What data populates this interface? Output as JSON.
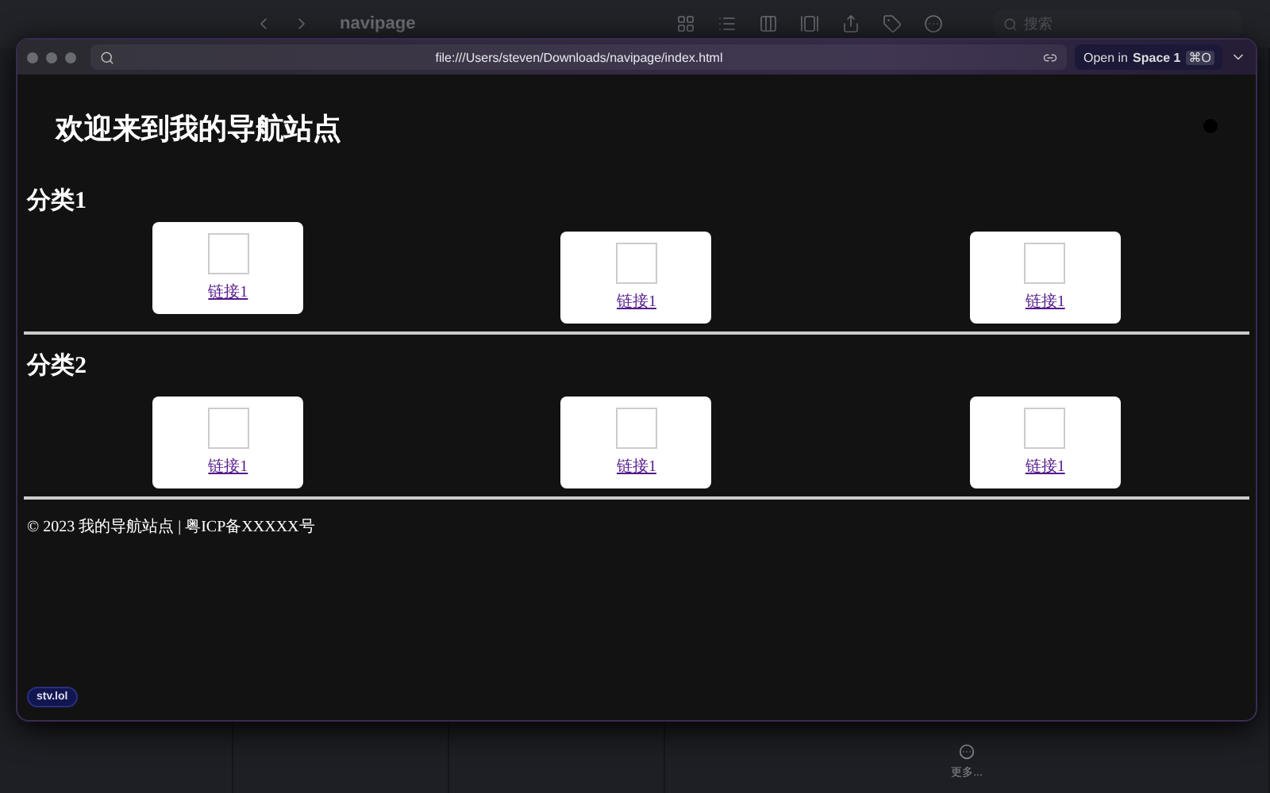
{
  "finder": {
    "title": "navipage",
    "search": {
      "placeholder": "搜索"
    },
    "more": "更多..."
  },
  "browser": {
    "url": "file:///Users/steven/Downloads/navipage/index.html",
    "open_in": {
      "prefix": "Open in",
      "space": "Space 1",
      "shortcut": "⌘O"
    },
    "badge": "stv.lol"
  },
  "page": {
    "title": "欢迎来到我的导航站点",
    "sections": [
      {
        "heading": "分类1",
        "links": [
          {
            "label": "链接1"
          },
          {
            "label": "链接1"
          },
          {
            "label": "链接1"
          }
        ]
      },
      {
        "heading": "分类2",
        "links": [
          {
            "label": "链接1"
          },
          {
            "label": "链接1"
          },
          {
            "label": "链接1"
          }
        ]
      }
    ],
    "footer": "© 2023 我的导航站点 | 粤ICP备XXXXX号"
  }
}
